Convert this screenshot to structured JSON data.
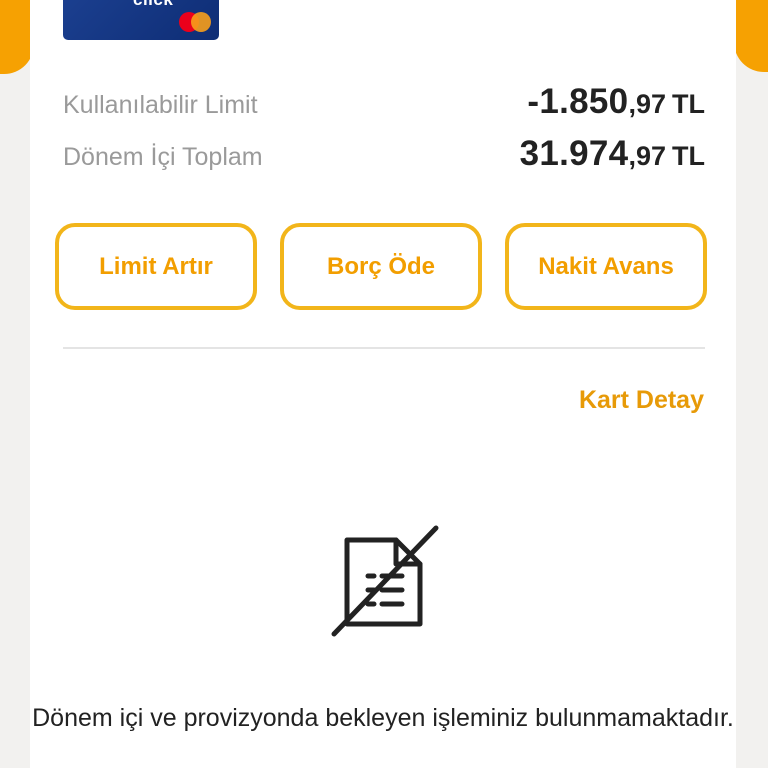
{
  "card": {
    "brand_text": "click",
    "network_icon": "mastercard-logo"
  },
  "summary": {
    "available_limit": {
      "label": "Kullanılabilir Limit",
      "integer": "-1.850",
      "decimal": ",97",
      "currency": "TL"
    },
    "period_total": {
      "label": "Dönem İçi Toplam",
      "integer": "31.974",
      "decimal": ",97",
      "currency": "TL"
    }
  },
  "actions": {
    "increase_limit": "Limit Artır",
    "pay_debt": "Borç Öde",
    "cash_advance": "Nakit Avans"
  },
  "card_detail_link": "Kart Detay",
  "empty_state": {
    "icon": "no-documents-icon",
    "message": "Dönem içi ve provizyonda bekleyen işleminiz bulunmamaktadır."
  },
  "colors": {
    "accent": "#f6a102",
    "button_border": "#f2b51a",
    "button_text": "#f29e00",
    "link": "#e79a08",
    "card": "#1b3f8f"
  }
}
